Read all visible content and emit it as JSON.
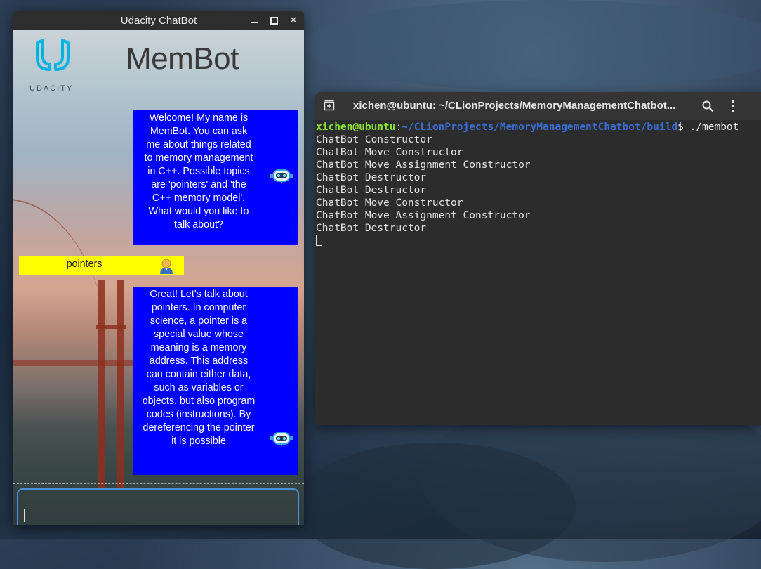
{
  "chatbot_window": {
    "title": "Udacity ChatBot",
    "logo_caption": "UDACITY",
    "app_title": "MemBot",
    "messages": [
      {
        "sender": "bot",
        "text": "Welcome! My name is MemBot. You can ask me about things related to memory management in C++. Possible topics are 'pointers' and 'the C++ memory model'. What would you like to talk about?"
      },
      {
        "sender": "user",
        "text": "pointers"
      },
      {
        "sender": "bot",
        "text": "Great! Let's talk about pointers. In computer science, a pointer is a special value whose meaning is a memory address. This address can contain either data, such as variables or objects, but also program codes (instructions). By dereferencing the pointer it is possible"
      }
    ],
    "input_value": ""
  },
  "terminal_window": {
    "title": "xichen@ubuntu: ~/CLionProjects/MemoryManagementChatbot...",
    "prompt_user": "xichen@ubuntu",
    "prompt_sep": ":",
    "prompt_path": "~/CLionProjects/MemoryManagementChatbot/build",
    "prompt_symbol": "$",
    "command": " ./membot",
    "output_lines": [
      "ChatBot Constructor",
      "ChatBot Move Constructor",
      "ChatBot Move Assignment Constructor",
      "ChatBot Destructor",
      "ChatBot Destructor",
      "ChatBot Move Constructor",
      "ChatBot Move Assignment Constructor",
      "ChatBot Destructor"
    ]
  },
  "colors": {
    "bot_bubble": "#0000ff",
    "user_bubble": "#ffff00",
    "input_focus": "#4a90d9",
    "prompt_user": "#8ae234",
    "prompt_path": "#3a6fd8"
  },
  "icons": [
    "close-icon",
    "maximize-icon",
    "minimize-icon",
    "udacity-logo-icon",
    "chatbot-avatar-icon",
    "user-avatar-icon",
    "new-tab-icon",
    "search-icon",
    "menu-icon"
  ]
}
